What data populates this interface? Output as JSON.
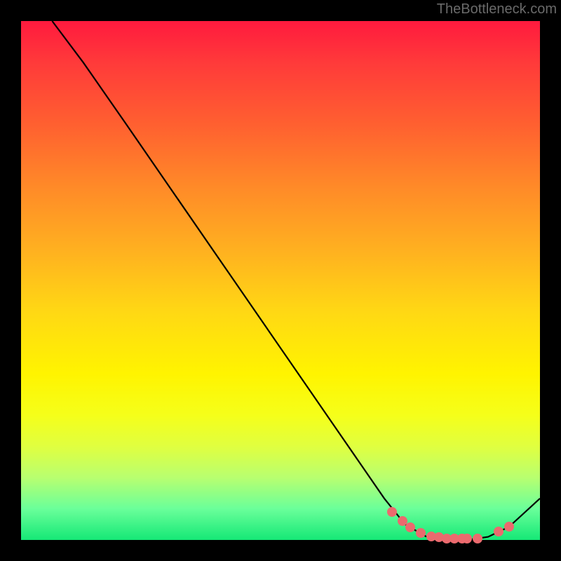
{
  "attribution": "TheBottleneck.com",
  "chart_data": {
    "type": "line",
    "title": "",
    "xlabel": "",
    "ylabel": "",
    "xlim": [
      0,
      100
    ],
    "ylim": [
      0,
      100
    ],
    "series": [
      {
        "name": "curve",
        "x": [
          6,
          12,
          20,
          30,
          40,
          50,
          60,
          70,
          74,
          78,
          82,
          86,
          90,
          94,
          100
        ],
        "y": [
          100,
          92,
          80.5,
          66,
          51.5,
          37,
          22.5,
          8,
          3,
          0.7,
          0,
          0,
          0.6,
          2.5,
          8
        ]
      }
    ],
    "markers": {
      "name": "highlight-dots",
      "x": [
        71.5,
        73.5,
        75,
        77,
        79,
        80.5,
        82,
        83.5,
        85,
        86,
        88,
        92,
        94
      ],
      "y": [
        5.4,
        3.6,
        2.4,
        1.3,
        0.7,
        0.5,
        0.3,
        0.3,
        0.3,
        0.3,
        0.3,
        1.6,
        2.6
      ]
    }
  }
}
